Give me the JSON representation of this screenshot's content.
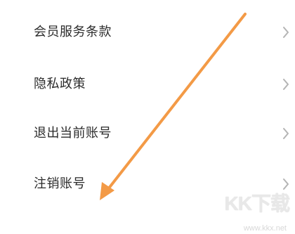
{
  "settings": {
    "items": [
      {
        "label": "会员服务条款"
      },
      {
        "label": "隐私政策"
      },
      {
        "label": "退出当前账号"
      },
      {
        "label": "注销账号"
      }
    ]
  },
  "annotation": {
    "arrow_color": "#f39a46",
    "icon": "arrow-pointing-to-deactivate-account"
  },
  "watermark": {
    "logo_text": "KK下载",
    "url": "www.kkx.net"
  },
  "colors": {
    "text": "#2b2b2b",
    "chevron": "#b4b4b4",
    "background": "#ffffff"
  }
}
